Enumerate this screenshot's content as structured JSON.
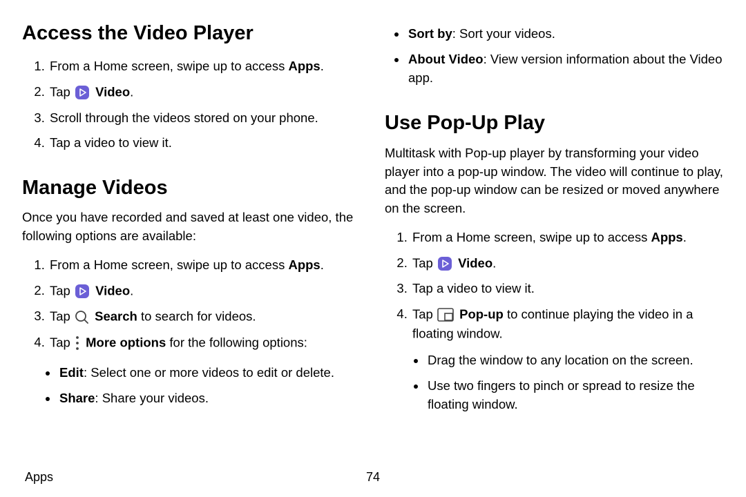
{
  "footer": {
    "section": "Apps",
    "page": "74"
  },
  "labels": {
    "apps": "Apps",
    "video": "Video",
    "search": "Search",
    "more_options": "More options",
    "popup": "Pop-up"
  },
  "left": {
    "h_access": "Access the Video Player",
    "access_steps": {
      "s1_pre": "From a Home screen, swipe up to access ",
      "s1_post": ".",
      "s2_pre": "Tap ",
      "s2_post": ".",
      "s3": "Scroll through the videos stored on your phone.",
      "s4": "Tap a video to view it."
    },
    "h_manage": "Manage Videos",
    "manage_intro": "Once you have recorded and saved at least one video, the following options are available:",
    "manage_steps": {
      "s1_pre": "From a Home screen, swipe up to access ",
      "s1_post": ".",
      "s2_pre": "Tap ",
      "s2_post": ".",
      "s3_pre": "Tap ",
      "s3_post": " to search for videos.",
      "s4_pre": "Tap ",
      "s4_post": " for the following options:"
    },
    "manage_opts": {
      "edit_b": "Edit",
      "edit_t": ": Select one or more videos to edit or delete.",
      "share_b": "Share",
      "share_t": ": Share your videos."
    }
  },
  "right": {
    "cont_opts": {
      "sort_b": "Sort by",
      "sort_t": ": Sort your videos.",
      "about_b": "About Video",
      "about_t": ": View version information about the Video app."
    },
    "h_popup": "Use Pop-Up Play",
    "popup_intro": "Multitask with Pop-up player by transforming your video player into a pop-up window. The video will continue to play, and the pop-up window can be resized or moved anywhere on the screen.",
    "popup_steps": {
      "s1_pre": "From a Home screen, swipe up to access ",
      "s1_post": ".",
      "s2_pre": "Tap ",
      "s2_post": ".",
      "s3": "Tap a video to view it.",
      "s4_pre": "Tap ",
      "s4_post": " to continue playing the video in a floating window."
    },
    "popup_sub": {
      "a": "Drag the window to any location on the screen.",
      "b": "Use two fingers to pinch or spread to resize the floating window."
    }
  }
}
